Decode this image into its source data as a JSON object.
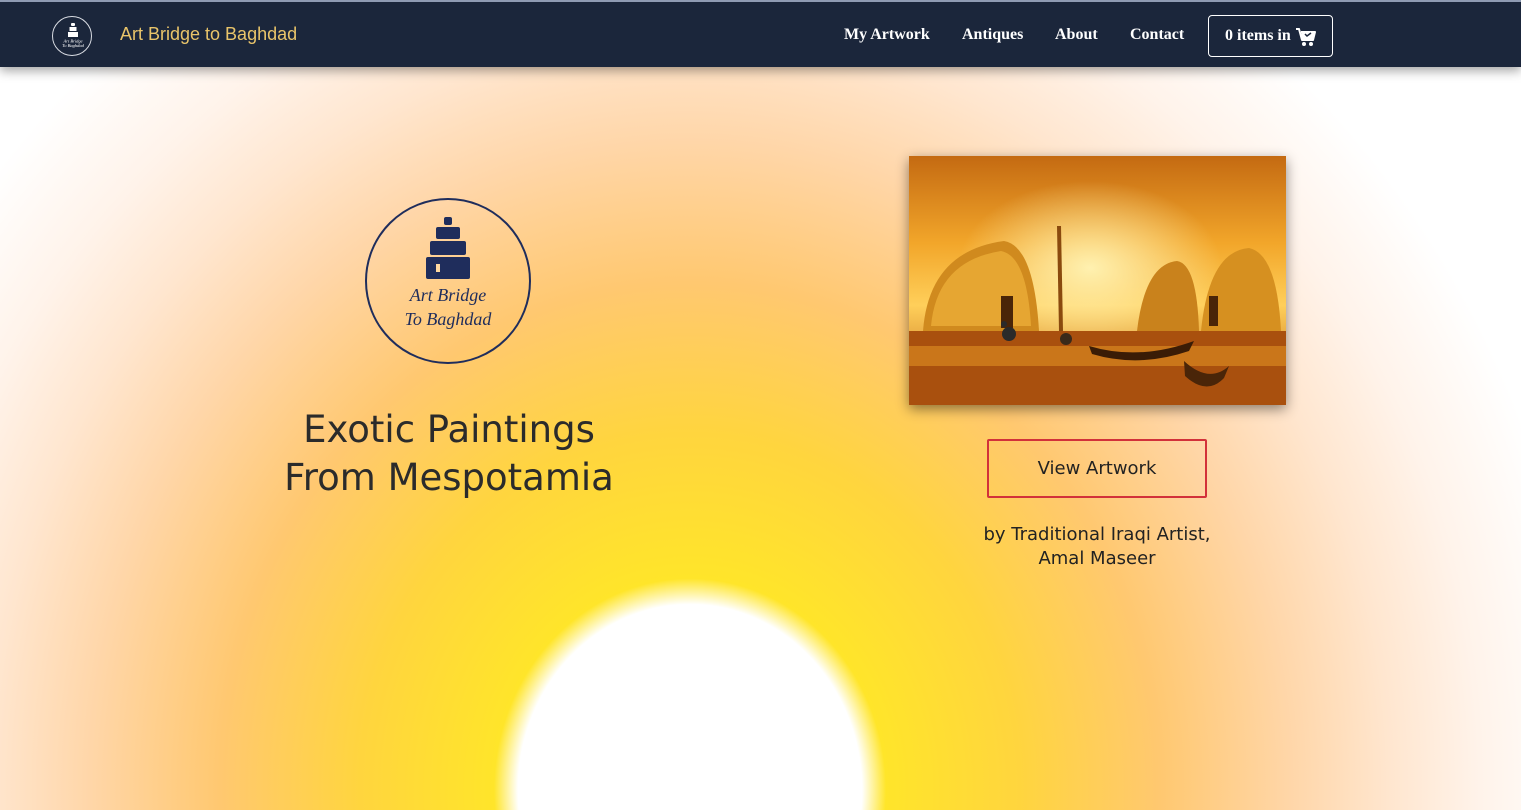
{
  "navbar": {
    "brand": "Art Bridge to Baghdad",
    "logo_lines": [
      "Art Bridge",
      "To Baghdad"
    ],
    "links": [
      {
        "label": "My Artwork"
      },
      {
        "label": "Antiques"
      },
      {
        "label": "About"
      },
      {
        "label": "Contact"
      }
    ],
    "cart_label": "0 items in",
    "cart_icon": "shopping-cart-icon"
  },
  "hero": {
    "logo_lines": [
      "Art Bridge",
      "To Baghdad"
    ],
    "title_lines": [
      "Exotic Paintings",
      "From Mespotamia"
    ]
  },
  "feature": {
    "image_icon": "reed-houses-painting",
    "button_label": "View Artwork",
    "caption_lines": [
      "by Traditional Iraqi Artist,",
      "Amal Maseer"
    ]
  },
  "colors": {
    "navbar": "#1b263b",
    "brand": "#e9c46a",
    "button_border": "#d2313a",
    "logo_navy": "#1f2d5c"
  }
}
